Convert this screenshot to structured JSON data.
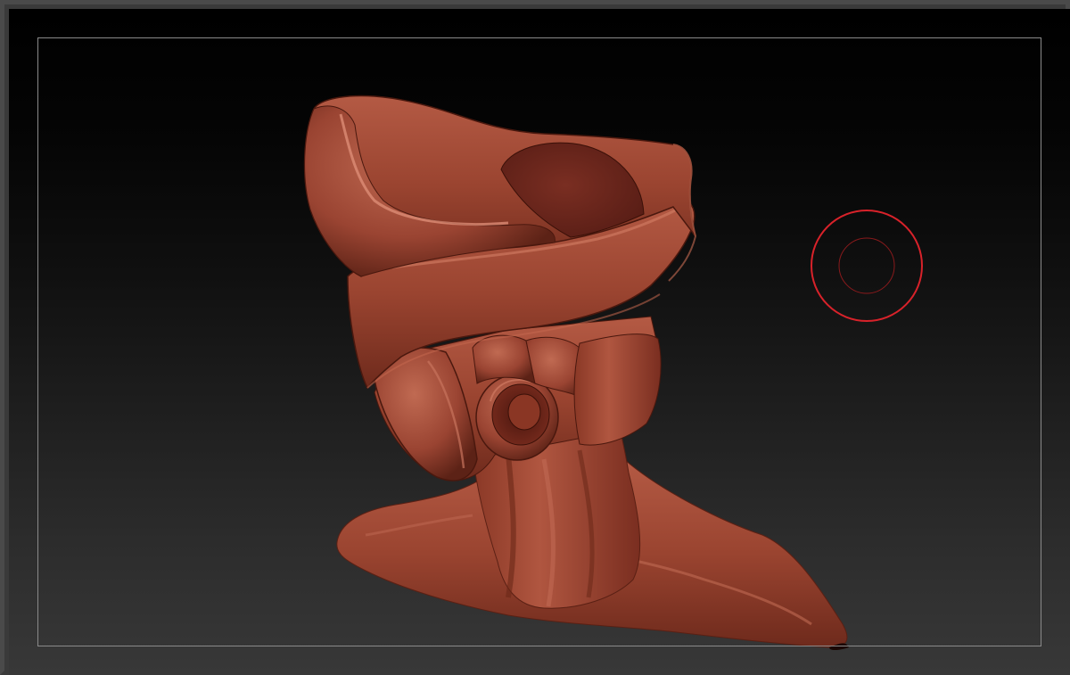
{
  "app": {
    "window": "3d-sculpting-canvas"
  },
  "viewport": {
    "background_top": "#000000",
    "background_bottom": "#383838",
    "frame_color": "#8a8a8a"
  },
  "model": {
    "name": "sculpted-head-bust",
    "material_color": "#a04834",
    "highlight_color": "#d8806a",
    "shadow_color": "#3a120a"
  },
  "brush_cursor": {
    "outer_color": "#d8222a",
    "inner_color": "#8a1a1c"
  }
}
